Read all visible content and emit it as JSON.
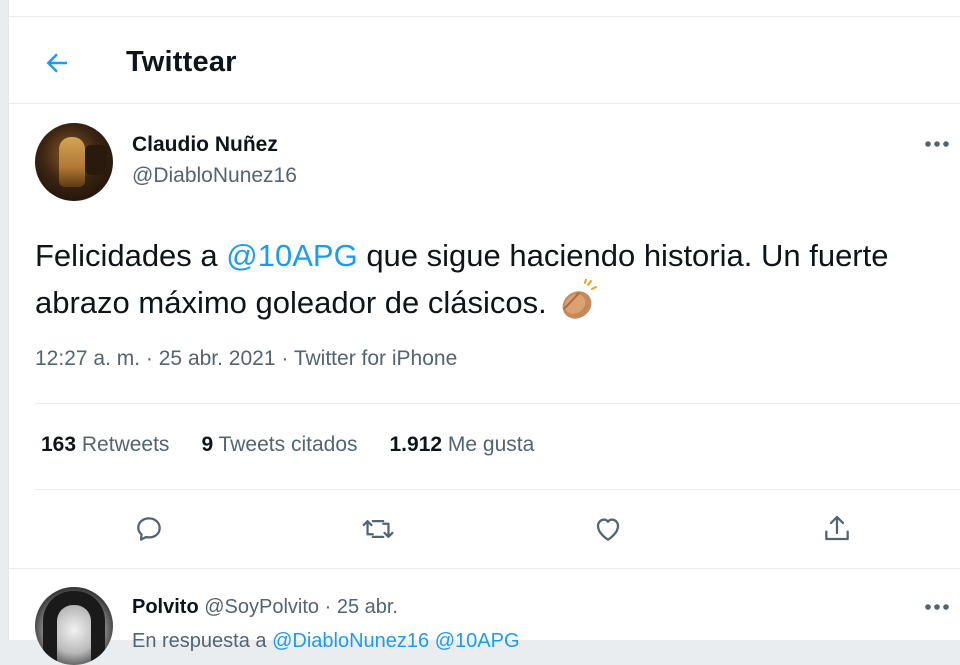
{
  "header": {
    "title": "Twittear",
    "back_icon": "arrow-left-icon"
  },
  "tweet": {
    "author_name": "Claudio Nuñez",
    "author_handle": "@DiabloNunez16",
    "text_before": "Felicidades a ",
    "mention": "@10APG",
    "text_after": " que sigue haciendo historia. Un fuerte abrazo máximo goleador de clásicos.",
    "emoji": "clapping-hands-icon",
    "time": "12:27 a. m.",
    "date": "25 abr. 2021",
    "client": "Twitter for iPhone",
    "sep": "·",
    "stats": {
      "retweets_count": "163",
      "retweets_label": "Retweets",
      "quotes_count": "9",
      "quotes_label": "Tweets citados",
      "likes_count": "1.912",
      "likes_label": "Me gusta"
    },
    "actions": [
      "reply-icon",
      "retweet-icon",
      "like-icon",
      "share-icon"
    ]
  },
  "reply": {
    "name": "Polvito",
    "handle": "@SoyPolvito",
    "date": "25 abr.",
    "sep": "·",
    "snippet_prefix": "En respuesta a",
    "snippet_mention1": "@DiabloNunez16",
    "snippet_mention2": "@10APG"
  },
  "colors": {
    "accent": "#1d9bf0",
    "muted": "#536471",
    "text": "#0f1419"
  }
}
